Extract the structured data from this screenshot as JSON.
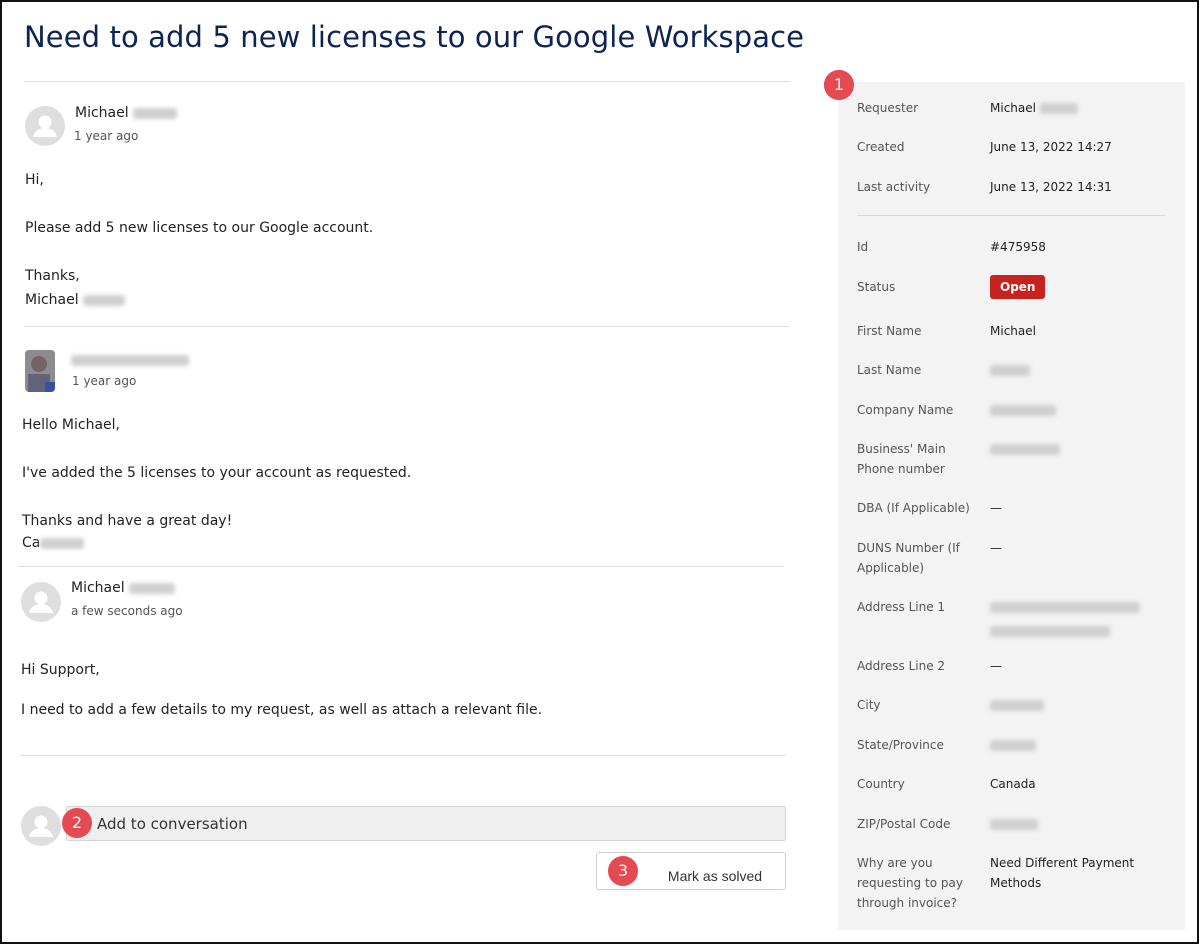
{
  "ticket": {
    "title": "Need to add 5 new licenses to our Google Workspace"
  },
  "messages": [
    {
      "author_first": "Michael",
      "time": "1 year ago",
      "lines": [
        "Hi,",
        "",
        "Please add 5 new licenses to our Google account.",
        "",
        "Thanks,",
        "Michael"
      ]
    },
    {
      "author_first": "",
      "time": "1 year ago",
      "lines": [
        "Hello Michael,",
        "",
        "I've added the 5 licenses to your account as requested.",
        "",
        "Thanks and have a great day!",
        "Ca"
      ]
    },
    {
      "author_first": "Michael",
      "time": "a few seconds ago",
      "lines": [
        "Hi Support,",
        "",
        "I need to add a few details to my request, as well as attach a relevant file."
      ]
    }
  ],
  "compose": {
    "placeholder": "Add to conversation"
  },
  "actions": {
    "mark_solved": "Mark as solved"
  },
  "markers": [
    "1",
    "2",
    "3"
  ],
  "details": {
    "requester_label": "Requester",
    "requester_value": "Michael",
    "created_label": "Created",
    "created_value": "June 13, 2022 14:27",
    "last_activity_label": "Last activity",
    "last_activity_value": "June 13, 2022 14:31",
    "id_label": "Id",
    "id_value": "#475958",
    "status_label": "Status",
    "status_value": "Open",
    "first_name_label": "First Name",
    "first_name_value": "Michael",
    "last_name_label": "Last Name",
    "company_label": "Company Name",
    "phone_label": "Business' Main Phone number",
    "dba_label": "DBA (If Applicable)",
    "dba_value": "—",
    "duns_label": "DUNS Number (If Applicable)",
    "duns_value": "—",
    "address1_label": "Address Line 1",
    "address2_label": "Address Line 2",
    "address2_value": "—",
    "city_label": "City",
    "state_label": "State/Province",
    "country_label": "Country",
    "country_value": "Canada",
    "zip_label": "ZIP/Postal Code",
    "invoice_label": "Why are you requesting to pay through invoice?",
    "invoice_value": "Need Different Payment Methods"
  },
  "colors": {
    "title": "#0d2354",
    "status_open": "#c8221f",
    "marker": "#e34a52",
    "panel": "#f3f3f3"
  }
}
